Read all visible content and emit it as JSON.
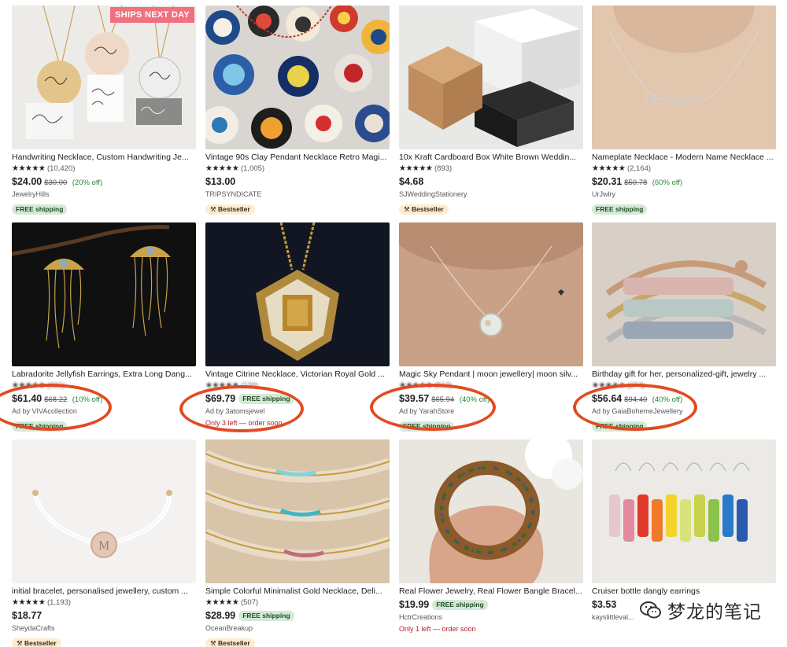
{
  "products": [
    {
      "title": "Handwriting Necklace, Custom Handwriting Je...",
      "stars": "★★★★★",
      "reviews": "(10,420)",
      "price": "$24.00",
      "old_price": "$30.00",
      "discount": "(20% off)",
      "shop": "JewelryHills",
      "badge": "FREE shipping",
      "ships_next_day": "SHIPS NEXT DAY"
    },
    {
      "title": "Vintage 90s Clay Pendant Necklace Retro Magi...",
      "stars": "★★★★★",
      "reviews": "(1,005)",
      "price": "$13.00",
      "shop": "TRIPSYNDICATE",
      "badge": "Bestseller"
    },
    {
      "title": "10x Kraft Cardboard Box White Brown Weddin...",
      "stars": "★★★★★",
      "reviews": "(893)",
      "price": "$4.68",
      "shop": "SJWeddingStationery",
      "badge": "Bestseller"
    },
    {
      "title": "Nameplate Necklace - Modern Name Necklace ...",
      "stars": "★★★★★",
      "reviews": "(2,164)",
      "price": "$20.31",
      "old_price": "$50.78",
      "discount": "(60% off)",
      "shop": "UrJwlry",
      "badge": "FREE shipping"
    },
    {
      "title": "Labradorite Jellyfish Earrings, Extra Long Dang...",
      "stars": "★★★★★",
      "reviews": "(321)",
      "price": "$61.40",
      "old_price": "$68.22",
      "discount": "(10% off)",
      "shop": "Ad by VIVAcollection",
      "badge": "FREE shipping"
    },
    {
      "title": "Vintage Citrine Necklace, Victorian Royal Gold ...",
      "stars": "★★★★★",
      "reviews": "(120)",
      "price": "$69.79",
      "inline_free": "FREE shipping",
      "shop": "Ad by 3atomsjewel",
      "low_stock": "Only 3 left — order soon"
    },
    {
      "title": "Magic Sky Pendant | moon jewellery| moon silv...",
      "stars": "★★★★★",
      "reviews": "(512)",
      "price": "$39.57",
      "old_price": "$65.94",
      "discount": "(40% off)",
      "shop": "Ad by YarahStore",
      "badge": "FREE shipping"
    },
    {
      "title": "Birthday gift for her, personalized-gift, jewelry ...",
      "stars": "★★★★★",
      "reviews": "(274)",
      "price": "$56.64",
      "old_price": "$94.40",
      "discount": "(40% off)",
      "shop": "Ad by GaiaBohemeJewellery",
      "badge": "FREE shipping"
    },
    {
      "title": "initial bracelet, personalised jewellery, custom ...",
      "stars": "★★★★★",
      "reviews": "(1,193)",
      "price": "$18.77",
      "shop": "SheydaCrafts",
      "badge": "Bestseller"
    },
    {
      "title": "Simple Colorful Minimalist Gold Necklace, Deli...",
      "stars": "★★★★★",
      "reviews": "(507)",
      "price": "$28.99",
      "inline_free": "FREE shipping",
      "shop": "OceanBreakup",
      "badge": "Bestseller"
    },
    {
      "title": "Real Flower Jewelry, Real Flower Bangle Bracel...",
      "price": "$19.99",
      "inline_free": "FREE shipping",
      "shop": "HctrCreations",
      "low_stock": "Only 1 left — order soon"
    },
    {
      "title": "Cruiser bottle dangly earrings",
      "price": "$3.53",
      "shop": "kayslittleval..."
    }
  ],
  "watermark": {
    "text": "梦龙的笔记",
    "icon": "wechat-icon"
  },
  "colors": {
    "highlight_circle": "#e24a22",
    "free_badge_bg": "#d4e9d7",
    "bestseller_bg": "#fdebd2",
    "discount_green": "#258635",
    "sale_badge": "#f26f7e"
  }
}
